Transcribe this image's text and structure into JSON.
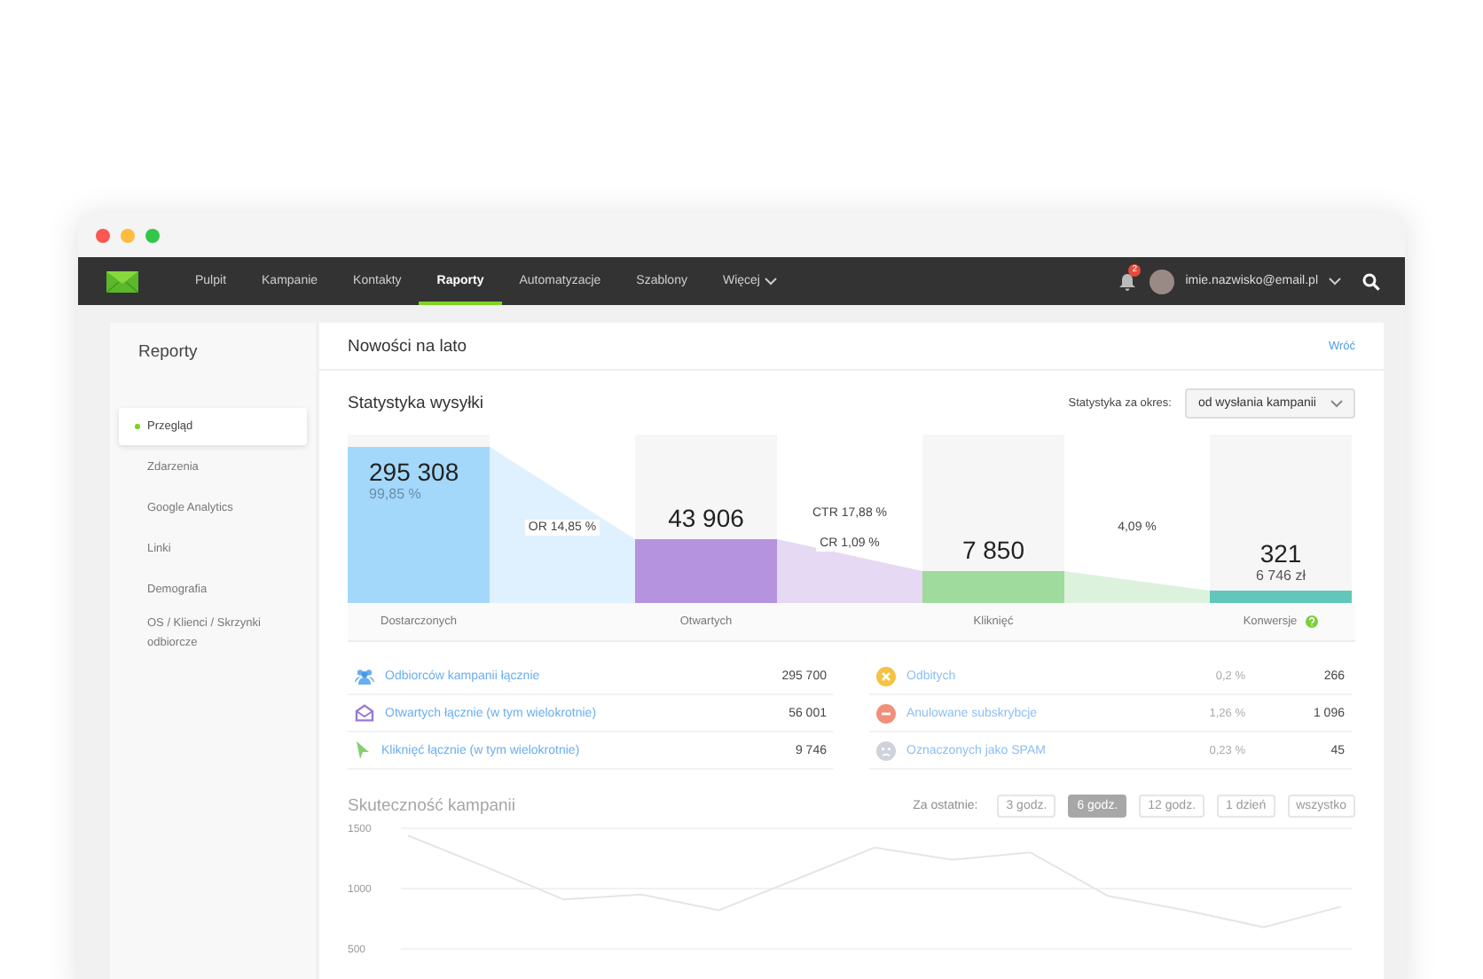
{
  "nav": {
    "items": [
      {
        "label": "Pulpit",
        "selected": false,
        "kind": "link"
      },
      {
        "label": "Kampanie",
        "selected": false,
        "kind": "link"
      },
      {
        "label": "Kontakty",
        "selected": false,
        "kind": "link"
      },
      {
        "label": "Raporty",
        "selected": true,
        "kind": "link"
      },
      {
        "label": "Automatyzacje",
        "selected": false,
        "kind": "link"
      },
      {
        "label": "Szablony",
        "selected": false,
        "kind": "link"
      },
      {
        "label": "Więcej",
        "selected": false,
        "kind": "dropdown"
      }
    ],
    "notifications": {
      "count": "2"
    },
    "user": {
      "email": "imie.nazwisko@email.pl"
    }
  },
  "sidebar": {
    "title": "Reporty",
    "items": [
      {
        "label": "Przegląd",
        "selected": true
      },
      {
        "label": "Zdarzenia",
        "selected": false
      },
      {
        "label": "Google Analytics",
        "selected": false
      },
      {
        "label": "Linki",
        "selected": false
      },
      {
        "label": "Demografia",
        "selected": false
      },
      {
        "label": "OS / Klienci / Skrzynki odbiorcze",
        "selected": false
      }
    ]
  },
  "header": {
    "title": "Nowości na lato",
    "back_link": "Wróć"
  },
  "send_stats": {
    "title": "Statystyka wysyłki",
    "period_label": "Statystyka za okres:",
    "period_value": "od wysłania kampanii",
    "stages": [
      {
        "value": "295 308",
        "sub": "99,85 %",
        "label": "Dostarczonych",
        "level": 0.93,
        "color": "#a3d8fb",
        "help": false
      },
      {
        "value": "43 906",
        "label": "Otwartych",
        "level": 0.38,
        "color": "#b693de",
        "help": false
      },
      {
        "value": "7 850",
        "label": "Kliknięć",
        "level": 0.19,
        "color": "#9edb9c",
        "help": false
      },
      {
        "value": "321",
        "sub": "6 746 zł",
        "label": "Konwersje",
        "level": 0.07,
        "color": "#62c6bb",
        "help": true
      }
    ],
    "rates": [
      [
        "OR 14,85 %"
      ],
      [
        "CTR 17,88 %",
        "CR 1,09 %"
      ],
      [
        "4,09 %"
      ]
    ]
  },
  "totals": [
    {
      "kind": "people",
      "label": "Odbiorców kampanii łącznie",
      "value": "295 700"
    },
    {
      "kind": "envelope",
      "label": "Otwartych łącznie (w tym wielokrotnie)",
      "value": "56 001"
    },
    {
      "kind": "cursor",
      "label": "Kliknięć łącznie (w tym wielokrotnie)",
      "value": "9 746"
    }
  ],
  "issues": [
    {
      "kind": "bounce",
      "label": "Odbitych",
      "percent": "0,2 %",
      "value": "266"
    },
    {
      "kind": "unsubscribe",
      "label": "Anulowane subskrybcje",
      "percent": "1,26 %",
      "value": "1 096"
    },
    {
      "kind": "spam",
      "label": "Oznaczonych jako SPAM",
      "percent": "0,23 %",
      "value": "45"
    }
  ],
  "performance": {
    "title": "Skuteczność kampanii",
    "range_label": "Za ostatnie:",
    "ranges": [
      {
        "label": "3 godz.",
        "selected": false
      },
      {
        "label": "6 godz.",
        "selected": true
      },
      {
        "label": "12 godz.",
        "selected": false
      },
      {
        "label": "1 dzień",
        "selected": false
      },
      {
        "label": "wszystko",
        "selected": false
      }
    ],
    "chart_data": {
      "type": "line",
      "ylim": [
        500,
        1500
      ],
      "yticks": [
        500,
        1000,
        1500
      ],
      "series": [
        {
          "color": "#dddddd",
          "values": [
            1440,
            1180,
            910,
            950,
            820,
            1080,
            1340,
            1240,
            1300,
            940,
            820,
            680,
            850
          ]
        }
      ]
    }
  }
}
